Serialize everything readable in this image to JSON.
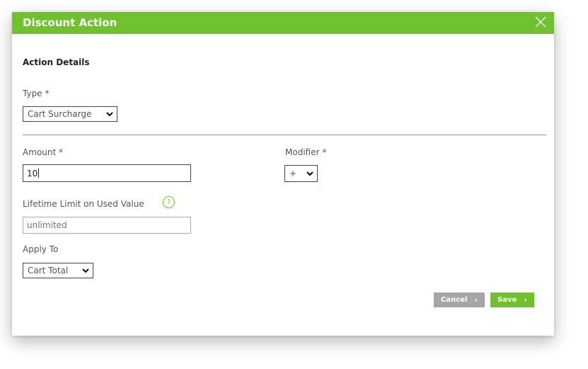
{
  "dialog": {
    "title": "Discount Action",
    "section_title": "Action Details"
  },
  "type_field": {
    "label": "Type *",
    "value": "Cart Surcharge"
  },
  "amount_field": {
    "label": "Amount *",
    "value": "10"
  },
  "modifier_field": {
    "label": "Modifier *",
    "value": "+"
  },
  "lifetime_field": {
    "label": "Lifetime Limit on Used Value",
    "placeholder": "unlimited",
    "help": "?"
  },
  "apply_field": {
    "label": "Apply To",
    "value": "Cart Total"
  },
  "buttons": {
    "cancel": "Cancel",
    "save": "Save",
    "arrow": "›"
  },
  "colors": {
    "accent": "#6fc12d",
    "cancel_bg": "#a6a6a6"
  }
}
